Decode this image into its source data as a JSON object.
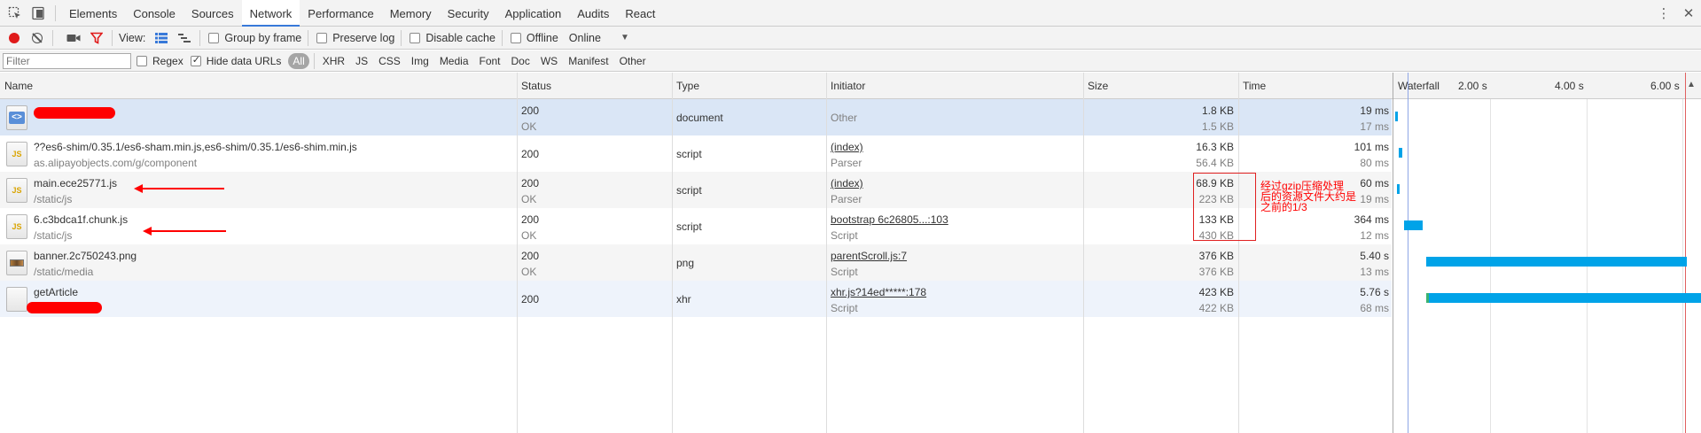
{
  "tabs": [
    "Elements",
    "Console",
    "Sources",
    "Network",
    "Performance",
    "Memory",
    "Security",
    "Application",
    "Audits",
    "React"
  ],
  "active_tab": "Network",
  "toolbar": {
    "view_label": "View:",
    "group_by_frame": "Group by frame",
    "preserve_log": "Preserve log",
    "disable_cache": "Disable cache",
    "offline": "Offline",
    "throttle": "Online"
  },
  "filterbar": {
    "placeholder": "Filter",
    "regex": "Regex",
    "hide_data_urls": "Hide data URLs",
    "types": [
      "All",
      "XHR",
      "JS",
      "CSS",
      "Img",
      "Media",
      "Font",
      "Doc",
      "WS",
      "Manifest",
      "Other"
    ]
  },
  "columns": {
    "name": "Name",
    "status": "Status",
    "type": "Type",
    "initiator": "Initiator",
    "size": "Size",
    "time": "Time",
    "waterfall": "Waterfall",
    "ticks": [
      "2.00 s",
      "4.00 s",
      "6.00 s"
    ]
  },
  "rows": [
    {
      "name": "",
      "path": "",
      "status": "200",
      "status_text": "OK",
      "type": "document",
      "initiator": "Other",
      "initiator_sub": "",
      "size": "1.8 KB",
      "size_sub": "1.5 KB",
      "time": "19 ms",
      "time_sub": "17 ms",
      "icon": "html-file-icon"
    },
    {
      "name": "??es6-shim/0.35.1/es6-sham.min.js,es6-shim/0.35.1/es6-shim.min.js",
      "path": "as.alipayobjects.com/g/component",
      "status": "200",
      "status_text": "",
      "type": "script",
      "initiator": "(index)",
      "initiator_sub": "Parser",
      "size": "16.3 KB",
      "size_sub": "56.4 KB",
      "time": "101 ms",
      "time_sub": "80 ms",
      "icon": "js-file-icon"
    },
    {
      "name": "main.ece25771.js",
      "path": "/static/js",
      "status": "200",
      "status_text": "OK",
      "type": "script",
      "initiator": "(index)",
      "initiator_sub": "Parser",
      "size": "68.9 KB",
      "size_sub": "223 KB",
      "time": "60 ms",
      "time_sub": "19 ms",
      "icon": "js-file-icon"
    },
    {
      "name": "6.c3bdca1f.chunk.js",
      "path": "/static/js",
      "status": "200",
      "status_text": "OK",
      "type": "script",
      "initiator": "bootstrap 6c26805...:103",
      "initiator_sub": "Script",
      "size": "133 KB",
      "size_sub": "430 KB",
      "time": "364 ms",
      "time_sub": "12 ms",
      "icon": "js-file-icon"
    },
    {
      "name": "banner.2c750243.png",
      "path": "/static/media",
      "status": "200",
      "status_text": "OK",
      "type": "png",
      "initiator": "parentScroll.js:7",
      "initiator_sub": "Script",
      "size": "376 KB",
      "size_sub": "376 KB",
      "time": "5.40 s",
      "time_sub": "13 ms",
      "icon": "png-file-icon"
    },
    {
      "name": "getArticle",
      "path": "",
      "status": "200",
      "status_text": "",
      "type": "xhr",
      "initiator": "xhr.js?14ed*****:178",
      "initiator_sub": "Script",
      "size": "423 KB",
      "size_sub": "422 KB",
      "time": "5.76 s",
      "time_sub": "68 ms",
      "icon": "blank-file-icon"
    }
  ],
  "annotation": {
    "line1": "经过gzip压缩处理",
    "line2": "后的资源文件大约是",
    "line3": "之前的1/3"
  },
  "colors": {
    "accent": "#3879d9",
    "waterfall_bar": "#00a3e8",
    "annotation": "#ff0000"
  }
}
